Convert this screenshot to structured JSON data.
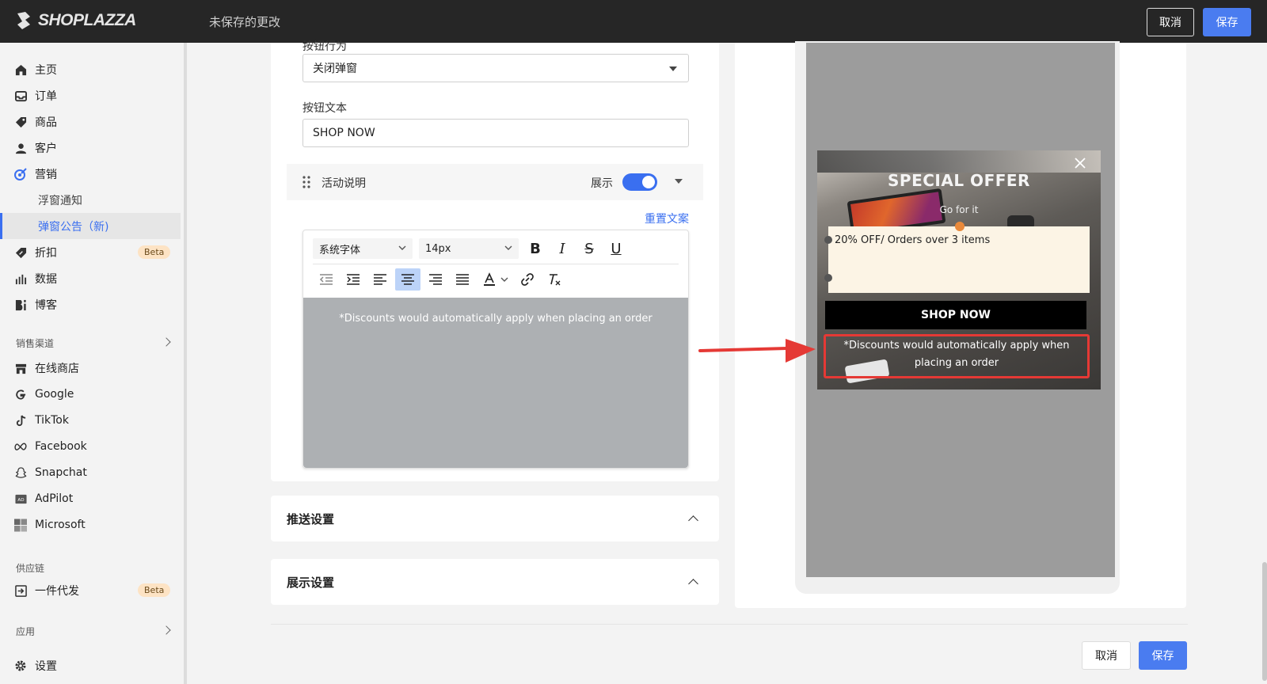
{
  "topbar": {
    "brand": "SHOPLAZZA",
    "unsaved_text": "未保存的更改",
    "cancel_label": "取消",
    "save_label": "保存"
  },
  "sidebar": {
    "items": [
      {
        "label": "主页",
        "icon": "home-icon"
      },
      {
        "label": "订单",
        "icon": "inbox-icon"
      },
      {
        "label": "商品",
        "icon": "tag-icon"
      },
      {
        "label": "客户",
        "icon": "user-icon"
      },
      {
        "label": "营销",
        "icon": "target-icon"
      },
      {
        "label": "浮窗通知"
      },
      {
        "label": "弹窗公告（新)"
      },
      {
        "label": "折扣",
        "icon": "discount-icon",
        "badge": "Beta"
      },
      {
        "label": "数据",
        "icon": "bar-chart-icon"
      },
      {
        "label": "博客",
        "icon": "blog-icon"
      }
    ],
    "sales_channels_title": "销售渠道",
    "channels": [
      {
        "label": "在线商店",
        "icon": "store-icon"
      },
      {
        "label": "Google",
        "icon": "google-icon"
      },
      {
        "label": "TikTok",
        "icon": "tiktok-icon"
      },
      {
        "label": "Facebook",
        "icon": "meta-icon"
      },
      {
        "label": "Snapchat",
        "icon": "snapchat-icon"
      },
      {
        "label": "AdPilot",
        "icon": "adpilot-icon"
      },
      {
        "label": "Microsoft",
        "icon": "microsoft-icon"
      }
    ],
    "supply_chain_title": "供应链",
    "supply": [
      {
        "label": "一件代发",
        "icon": "dropship-icon",
        "badge": "Beta"
      }
    ],
    "apps_title": "应用",
    "settings_label": "设置"
  },
  "form": {
    "button_action_label_partial": "按钮行为",
    "button_action_value": "关闭弹窗",
    "button_text_label": "按钮文本",
    "button_text_value": "SHOP NOW",
    "activity_desc_label": "活动说明",
    "show_label": "展示",
    "reset_copy_label": "重置文案",
    "font_family": "系统字体",
    "font_size": "14px",
    "editor_text": "*Discounts would automatically apply when placing an order"
  },
  "sections": {
    "push_settings": "推送设置",
    "display_settings": "展示设置"
  },
  "preview": {
    "title": "SPECIAL OFFER",
    "subtitle": "Go for it",
    "coupon_text": "20% OFF/ Orders over 3 items",
    "button_label": "SHOP NOW",
    "footnote": "*Discounts would automatically apply when placing an order"
  },
  "footer": {
    "cancel_label": "取消",
    "save_label": "保存"
  },
  "colors": {
    "accent": "#4a7cf0",
    "highlight_box": "#e53935",
    "beta_badge": "#fde3c4"
  }
}
